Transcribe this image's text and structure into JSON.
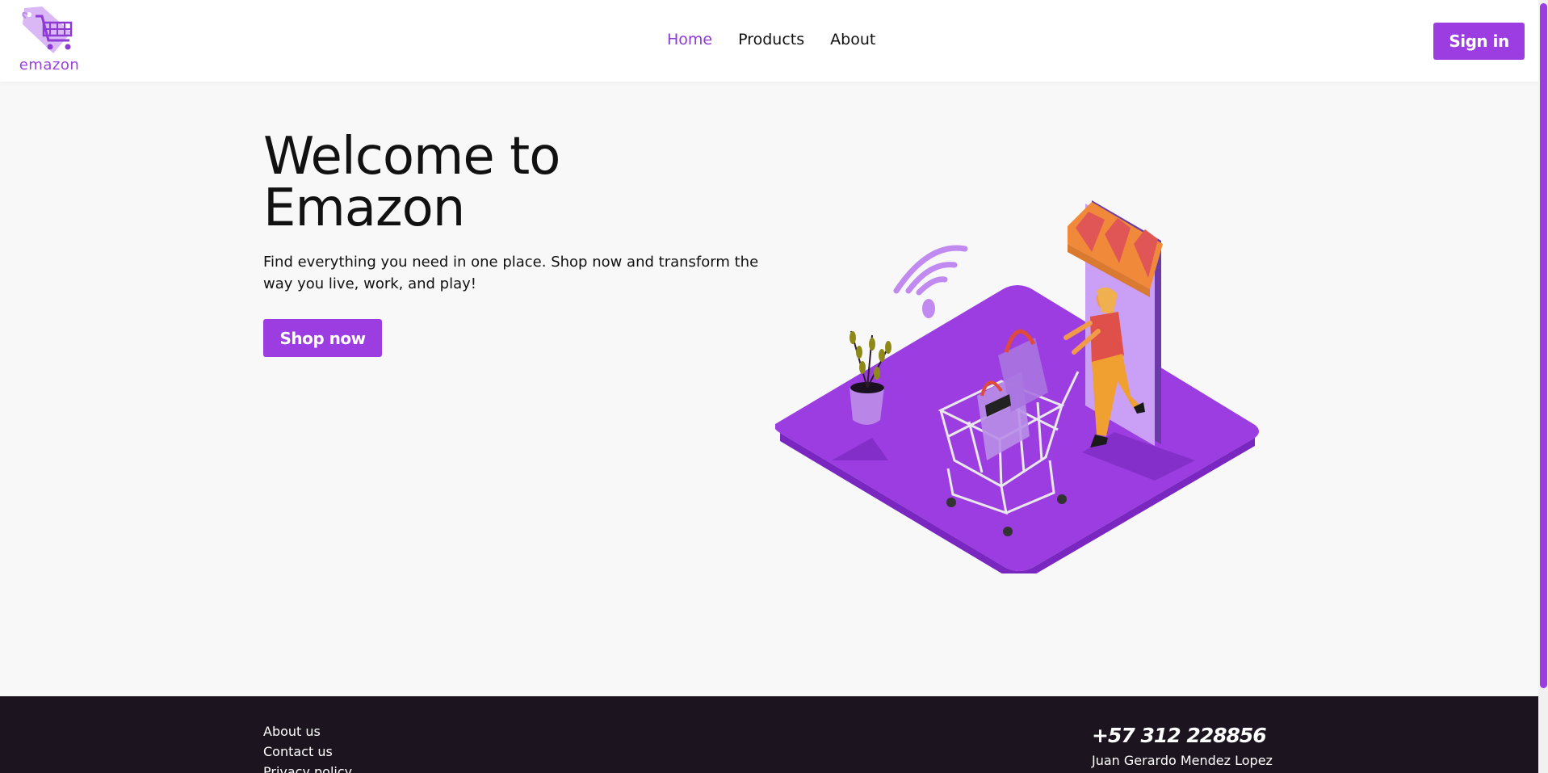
{
  "brand": {
    "name": "emazon",
    "accent": "#9b3de1"
  },
  "nav": {
    "items": [
      {
        "label": "Home",
        "active": true
      },
      {
        "label": "Products",
        "active": false
      },
      {
        "label": "About",
        "active": false
      }
    ],
    "signin_label": "Sign in"
  },
  "hero": {
    "title_line1": "Welcome to",
    "title_line2": "Emazon",
    "text": "Find everything you need in one place. Shop now and transform the way you live, work, and play!",
    "cta_label": "Shop now",
    "illustration": "shopping-cart-storefront-illustration"
  },
  "footer": {
    "links": [
      "About us",
      "Contact us",
      "Privacy policy"
    ],
    "phone": "+57 312 228856",
    "owner": "Juan Gerardo Mendez Lopez",
    "background": "#1c151f"
  }
}
